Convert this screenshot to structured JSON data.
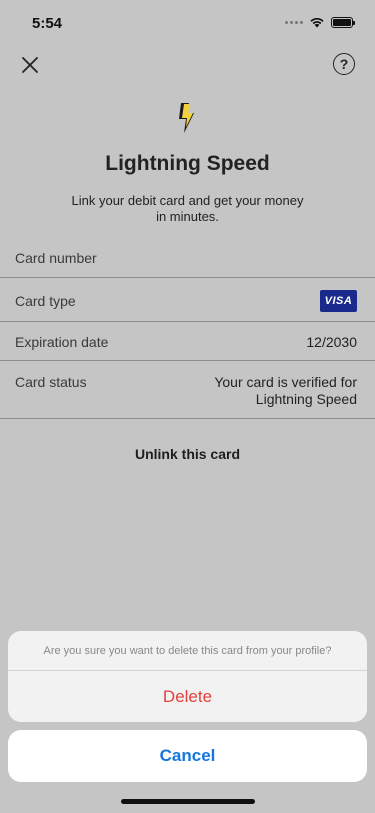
{
  "status_bar": {
    "time": "5:54"
  },
  "header": {
    "close_icon": "close-icon",
    "help_icon": "help-icon",
    "help_glyph": "?"
  },
  "hero": {
    "icon": "lightning-bolt-icon",
    "title": "Lightning Speed",
    "subtitle": "Link your debit card and get your money in minutes."
  },
  "card_details": {
    "rows": [
      {
        "label": "Card number",
        "value": ""
      },
      {
        "label": "Card type",
        "value": "VISA"
      },
      {
        "label": "Expiration date",
        "value": "12/2030"
      },
      {
        "label": "Card status",
        "value": "Your card is verified for Lightning Speed"
      }
    ]
  },
  "actions": {
    "unlink": "Unlink this card"
  },
  "action_sheet": {
    "message": "Are you sure you want to delete this card from your profile?",
    "delete_label": "Delete",
    "cancel_label": "Cancel"
  },
  "colors": {
    "background": "#c5c5c5",
    "destructive": "#e0423e",
    "link_blue": "#1677e0",
    "visa_blue": "#1a2a8c",
    "bolt_yellow": "#f2d13a"
  }
}
